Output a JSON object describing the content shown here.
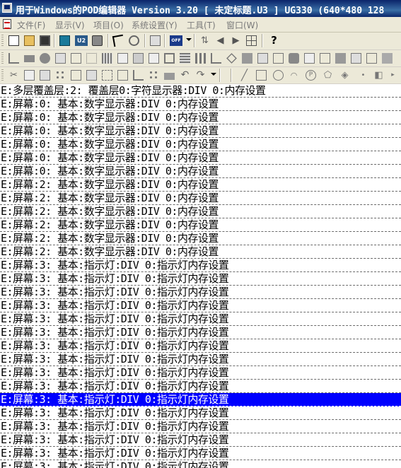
{
  "window": {
    "title": "用于Windows的POD编辑器 Version 3.20 [ 未定标题.U3 ] UG330  (640*480 128"
  },
  "menu": [
    "文件(F)",
    "显示(V)",
    "项目(O)",
    "系统设置(Y)",
    "工具(T)",
    "窗口(W)"
  ],
  "toolbar": {
    "u2_label": "U2",
    "off_label": "OFF",
    "help_label": "?"
  },
  "list": {
    "selected_index": 23,
    "rows": [
      "E:多层覆盖层:2:  覆盖层0:字符显示器:DIV 0:内存设置",
      "E:屏幕:0:  基本:数字显示器:DIV 0:内存设置",
      "E:屏幕:0:  基本:数字显示器:DIV 0:内存设置",
      "E:屏幕:0:  基本:数字显示器:DIV 0:内存设置",
      "E:屏幕:0:  基本:数字显示器:DIV 0:内存设置",
      "E:屏幕:0:  基本:数字显示器:DIV 0:内存设置",
      "E:屏幕:0:  基本:数字显示器:DIV 0:内存设置",
      "E:屏幕:2:  基本:数字显示器:DIV 0:内存设置",
      "E:屏幕:2:  基本:数字显示器:DIV 0:内存设置",
      "E:屏幕:2:  基本:数字显示器:DIV 0:内存设置",
      "E:屏幕:2:  基本:数字显示器:DIV 0:内存设置",
      "E:屏幕:2:  基本:数字显示器:DIV 0:内存设置",
      "E:屏幕:2:  基本:数字显示器:DIV 0:内存设置",
      "E:屏幕:3:  基本:指示灯:DIV 0:指示灯内存设置",
      "E:屏幕:3:  基本:指示灯:DIV 0:指示灯内存设置",
      "E:屏幕:3:  基本:指示灯:DIV 0:指示灯内存设置",
      "E:屏幕:3:  基本:指示灯:DIV 0:指示灯内存设置",
      "E:屏幕:3:  基本:指示灯:DIV 0:指示灯内存设置",
      "E:屏幕:3:  基本:指示灯:DIV 0:指示灯内存设置",
      "E:屏幕:3:  基本:指示灯:DIV 0:指示灯内存设置",
      "E:屏幕:3:  基本:指示灯:DIV 0:指示灯内存设置",
      "E:屏幕:3:  基本:指示灯:DIV 0:指示灯内存设置",
      "E:屏幕:3:  基本:指示灯:DIV 0:指示灯内存设置",
      "E:屏幕:3:  基本:指示灯:DIV 0:指示灯内存设置",
      "E:屏幕:3:  基本:指示灯:DIV 0:指示灯内存设置",
      "E:屏幕:3:  基本:指示灯:DIV 0:指示灯内存设置",
      "E:屏幕:3:  基本:指示灯:DIV 0:指示灯内存设置",
      "E:屏幕:3:  基本:指示灯:DIV 0:指示灯内存设置",
      "E:屏幕:3:  基本:指示灯:DIV 0:指示灯内存设置"
    ]
  }
}
